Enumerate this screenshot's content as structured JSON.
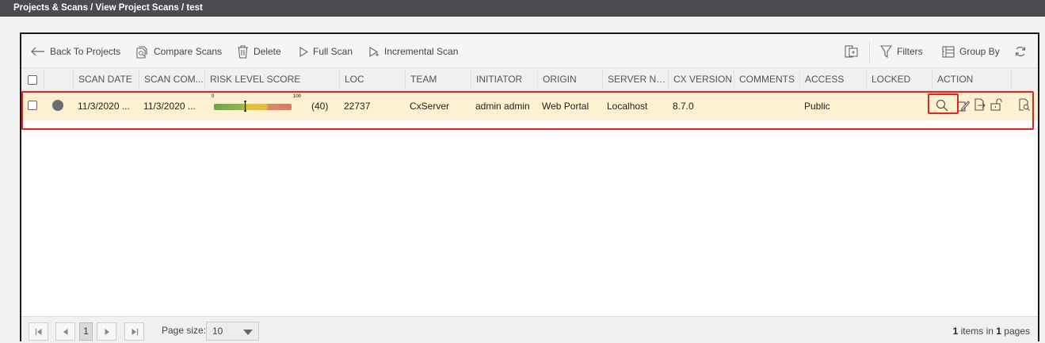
{
  "breadcrumb": "Projects & Scans / View Project Scans / test",
  "toolbar": {
    "back": "Back To Projects",
    "compare": "Compare Scans",
    "delete": "Delete",
    "full_scan": "Full Scan",
    "incremental_scan": "Incremental Scan",
    "filters": "Filters",
    "group_by": "Group By"
  },
  "columns": {
    "scan_date": "SCAN DATE",
    "scan_completed": "SCAN COM...",
    "risk_level_score": "RISK LEVEL SCORE",
    "loc": "LOC",
    "team": "TEAM",
    "initiator": "INITIATOR",
    "origin": "ORIGIN",
    "server_name": "SERVER NA...",
    "cx_version": "CX VERSION",
    "comments": "COMMENTS",
    "access": "ACCESS",
    "locked": "LOCKED",
    "action": "ACTION"
  },
  "scan_row": {
    "scan_date": "11/3/2020 ...",
    "scan_completed": "11/3/2020 ...",
    "risk_min_label": "0",
    "risk_max_label": "100",
    "risk_score": "(40)",
    "risk_score_value": 40,
    "loc": "22737",
    "team": "CxServer",
    "initiator": "admin admin",
    "origin": "Web Portal",
    "server_name": "Localhost",
    "cx_version": "8.7.0",
    "comments": "",
    "access": "Public",
    "locked": ""
  },
  "pager": {
    "current_page": "1",
    "page_size_label": "Page size:",
    "page_size_value": "10",
    "items_count": "1",
    "items_text_1": " items in ",
    "pages_count": "1",
    "items_text_2": " pages"
  },
  "colors": {
    "topbar": "#4b4b52",
    "row_highlight": "#fdf1d1",
    "annotation_red": "#e3231f"
  }
}
